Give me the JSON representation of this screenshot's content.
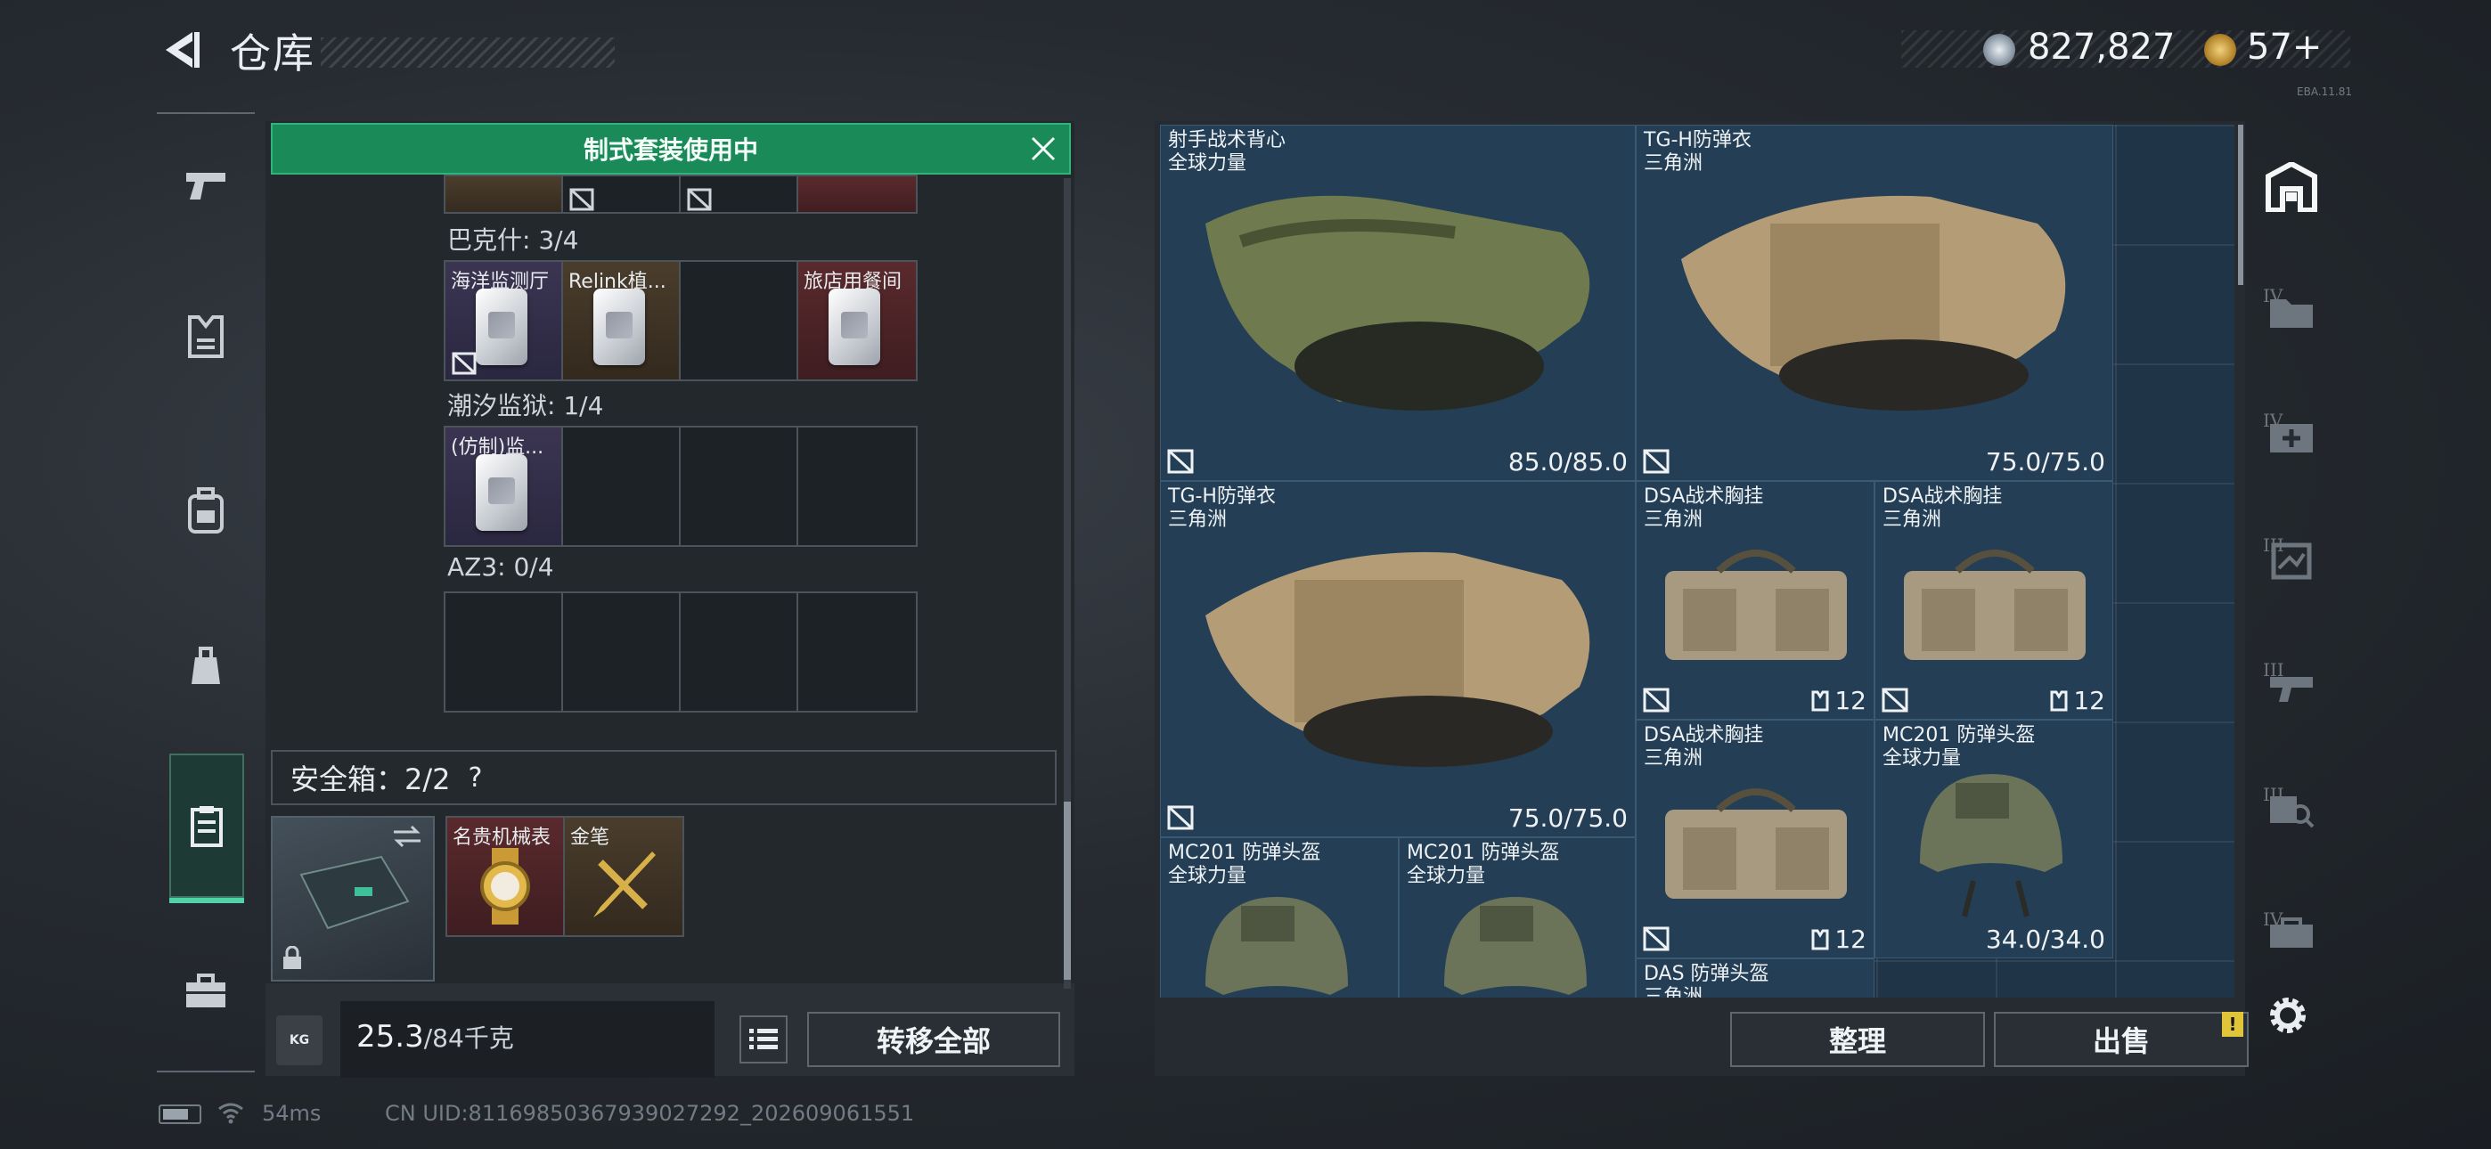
{
  "header": {
    "title": "仓库",
    "money": "827,827",
    "tickets": "57+",
    "version": "EBA.11.81"
  },
  "nav": {
    "items": [
      "weapons",
      "armor",
      "backpack",
      "bag",
      "storage",
      "toolbox"
    ],
    "active": "storage"
  },
  "banner": {
    "text": "制式套装使用中"
  },
  "sections": [
    {
      "label": "巴克什: 3/4",
      "cells": [
        "海洋监测厅",
        "Relink植...",
        "",
        "旅店用餐间"
      ]
    },
    {
      "label": "潮汐监狱: 1/4",
      "cells": [
        "(仿制)监..."
      ]
    },
    {
      "label": "AZ3: 0/4",
      "cells": []
    }
  ],
  "safe_box": {
    "label": "安全箱：2/2",
    "help": "?",
    "items": [
      "名贵机械表",
      "金笔"
    ]
  },
  "capacity": {
    "current": "25.3",
    "max": "/84千克",
    "unit_icon": "KG"
  },
  "buttons": {
    "transfer_all": "转移全部",
    "sort": "整理",
    "sell": "出售",
    "sell_badge": "!"
  },
  "stash": [
    {
      "name": "射手战术背心\n全球力量",
      "durability": "85.0/85.0"
    },
    {
      "name": "TG-H防弹衣\n三角洲",
      "durability": "75.0/75.0"
    },
    {
      "name": "TG-H防弹衣\n三角洲",
      "durability": "75.0/75.0"
    },
    {
      "name": "DSA战术胸挂\n三角洲",
      "capacity": "12"
    },
    {
      "name": "DSA战术胸挂\n三角洲",
      "capacity": "12"
    },
    {
      "name": "DSA战术胸挂\n三角洲",
      "capacity": "12"
    },
    {
      "name": "MC201 防弹头盔\n全球力量",
      "durability": "34.0/34.0"
    },
    {
      "name": "MC201 防弹头盔\n全球力量",
      "durability": ""
    },
    {
      "name": "MC201 防弹头盔\n全球力量",
      "durability": ""
    },
    {
      "name": "DAS 防弹头盔\n三角洲",
      "durability": ""
    }
  ],
  "filter": {
    "tiers": [
      "IV",
      "IV",
      "III",
      "III",
      "III",
      "IV"
    ]
  },
  "status": {
    "ping": "54ms",
    "uid": "CN UID:8116985036793902​7292_202609061551"
  },
  "colors": {
    "accent": "#4fd2a6",
    "banner": "#1a8a58",
    "stash_bg": "#1f3547",
    "warning": "#e0c43a"
  }
}
